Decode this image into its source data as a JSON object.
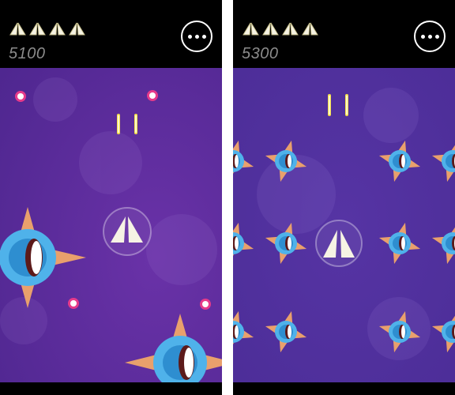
{
  "colors": {
    "background_purple": "#5a2b98",
    "header_black": "#000000",
    "enemy_orange": "#e9a06c",
    "enemy_blue": "#4fb2ea",
    "player_white": "#f6f3e4",
    "bullet_yellow": "#f4e04d",
    "orb_pink": "#e63a8a"
  },
  "panels": [
    {
      "lives_count": 4,
      "score": "5100",
      "menu_icon": "more-horizontal-icon"
    },
    {
      "lives_count": 4,
      "score": "5300",
      "menu_icon": "more-horizontal-icon"
    }
  ]
}
